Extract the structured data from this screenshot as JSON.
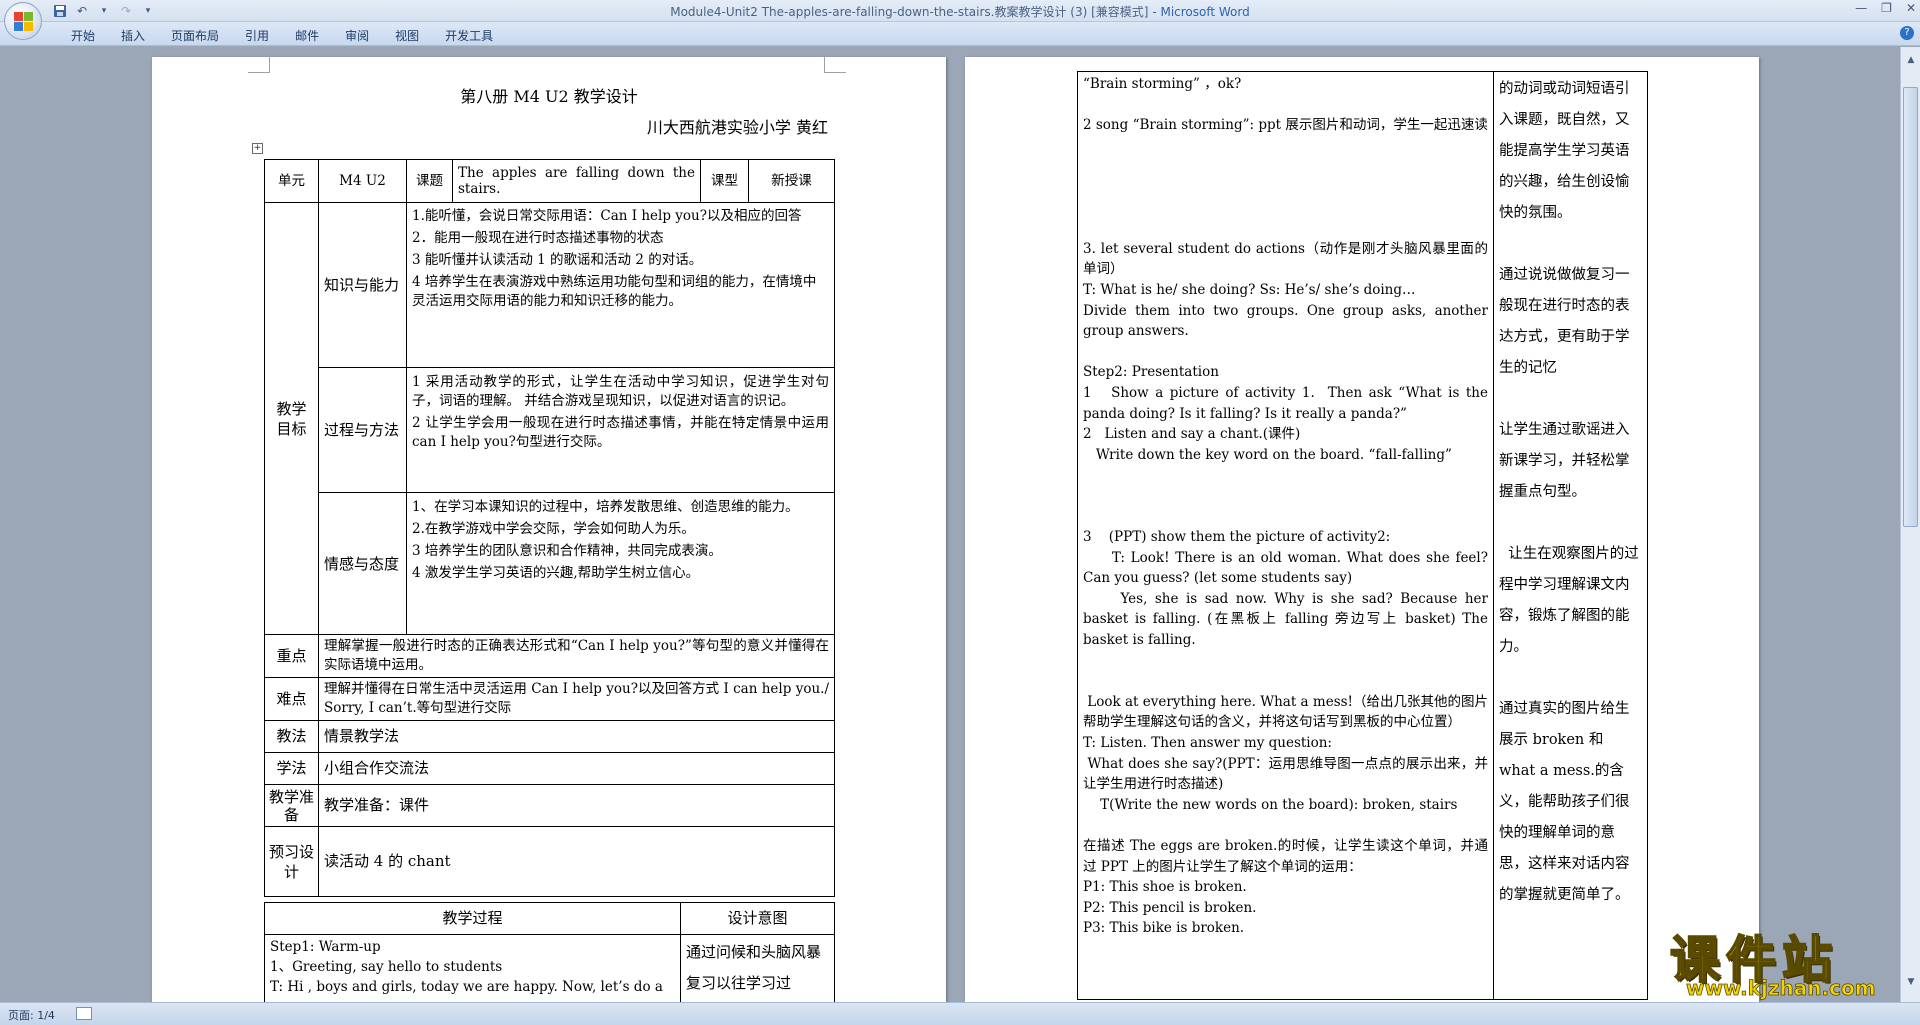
{
  "window": {
    "title": "Module4-Unit2 The-apples-are-falling-down-the-stairs.教案教学设计 (3) [兼容模式]",
    "app_name": "Microsoft Word"
  },
  "ribbon": {
    "tabs": [
      "开始",
      "插入",
      "页面布局",
      "引用",
      "邮件",
      "审阅",
      "视图",
      "开发工具"
    ]
  },
  "status": {
    "page_info": "页面: 1/4"
  },
  "page1": {
    "heading": "第八册 M4 U2  教学设计",
    "author": "川大西航港实验小学    黄红",
    "header_row": {
      "unit_label": "单元",
      "unit_value": "M4 U2",
      "lesson_label": "课题",
      "lesson_value": "The apples are falling down the stairs.",
      "type_label": "课型",
      "type_value": "新授课"
    },
    "goals": {
      "label": "教学目标",
      "knowledge": {
        "label": "知识与能力",
        "items": [
          "1.能听懂，会说日常交际用语：Can I help you?以及相应的回答",
          "2．能用一般现在进行时态描述事物的状态",
          "3 能听懂并认读活动 1 的歌谣和活动 2 的对话。",
          "4 培养学生在表演游戏中熟练运用功能句型和词组的能力，在情境中灵活运用交际用语的能力和知识迁移的能力。"
        ]
      },
      "process": {
        "label": "过程与方法",
        "items": [
          "1 采用活动教学的形式，让学生在活动中学习知识，促进学生对句子，词语的理解。 并结合游戏呈现知识，以促进对语言的识记。",
          "2 让学生学会用一般现在进行时态描述事情，并能在特定情景中运用 can I help you?句型进行交际。"
        ]
      },
      "emotion": {
        "label": "情感与态度",
        "items": [
          "1、在学习本课知识的过程中，培养发散思维、创造思维的能力。",
          "2.在教学游戏中学会交际，学会如何助人为乐。",
          "3 培养学生的团队意识和合作精神，共同完成表演。",
          "4 激发学生学习英语的兴趣,帮助学生树立信心。"
        ]
      }
    },
    "key_points": {
      "label": "重点",
      "text": "理解掌握一般进行时态的正确表达形式和“Can I help you?”等句型的意义并懂得在实际语境中运用。"
    },
    "difficulties": {
      "label": "难点",
      "text": "理解并懂得在日常生活中灵活运用 Can I help you?以及回答方式 I can help you./ Sorry, I can’t.等句型进行交际"
    },
    "teaching_method": {
      "label": "教法",
      "text": "情景教学法"
    },
    "learning_method": {
      "label": "学法",
      "text": "小组合作交流法"
    },
    "preparation": {
      "label": "教学准备",
      "text": "教学准备：课件"
    },
    "preview": {
      "label": "预习设计",
      "text": "读活动 4 的 chant"
    },
    "process_header": "教学过程",
    "intent_header": "设计意图",
    "process_start": [
      "Step1: Warm-up",
      "1、Greeting, say hello to students",
      "T: Hi , boys and girls, today we are happy. Now, let’s do a"
    ],
    "intent_start": "通过问候和头脑风暴复习以往学习过"
  },
  "page2": {
    "process_lines": [
      "“Brain storming” ，ok?",
      "",
      "2 song “Brain storming”: ppt 展示图片和动词，学生一起迅速读",
      "",
      "",
      "",
      "",
      "",
      "3. let several student do actions（动作是刚才头脑风暴里面的单词）",
      "T: What is he/ she doing? Ss: He’s/ she’s doing…",
      "Divide them into two groups. One group asks, another group answers.",
      "",
      "Step2: Presentation",
      "1   Show a picture of activity 1.  Then ask “What is the panda doing? Is it falling? Is it really a panda?”",
      "2   Listen and say a chant.(课件)",
      "   Write down the key word on the board. “fall-falling”",
      "",
      "",
      "",
      "3    (PPT) show them the picture of activity2:",
      "     T: Look! There is an old woman. What does she feel? Can you guess? (let some students say)",
      "     Yes, she is sad now. Why is she sad? Because her basket is falling. (在黑板上 falling 旁边写上 basket) The basket is falling.",
      "",
      "",
      " Look at everything here. What a mess!（给出几张其他的图片帮助学生理解这句话的含义，并将这句话写到黑板的中心位置）",
      "T: Listen. Then answer my question:",
      " What does she say?(PPT：运用思维导图一点点的展示出来，并让学生用进行时态描述)",
      "    T(Write the new words on the board): broken, stairs",
      "",
      "在描述 The eggs are broken.的时候，让学生读这个单词，并通过 PPT 上的图片让学生了解这个单词的运用：",
      "P1: This shoe is broken.",
      "P2: This pencil is broken.",
      "P3: This bike is broken."
    ],
    "intent_lines": [
      "的动词或动词短语引入课题，既自然，又能提高学生学习英语的兴趣，给生创设愉快的氛围。",
      "",
      "通过说说做做复习一般现在进行时态的表达方式，更有助于学生的记忆",
      "",
      "让学生通过歌谣进入新课学习，并轻松掌握重点句型。",
      "",
      "  让生在观察图片的过程中学习理解课文内容，锻炼了解图的能力。",
      "",
      "通过真实的图片给生展示 broken 和 what a mess.的含义，能帮助孩子们很快的理解单词的意思，这样来对话内容的掌握就更简单了。",
      "",
      ""
    ]
  },
  "watermark": {
    "text": "课件站",
    "url": "www.kjzhan.com"
  }
}
